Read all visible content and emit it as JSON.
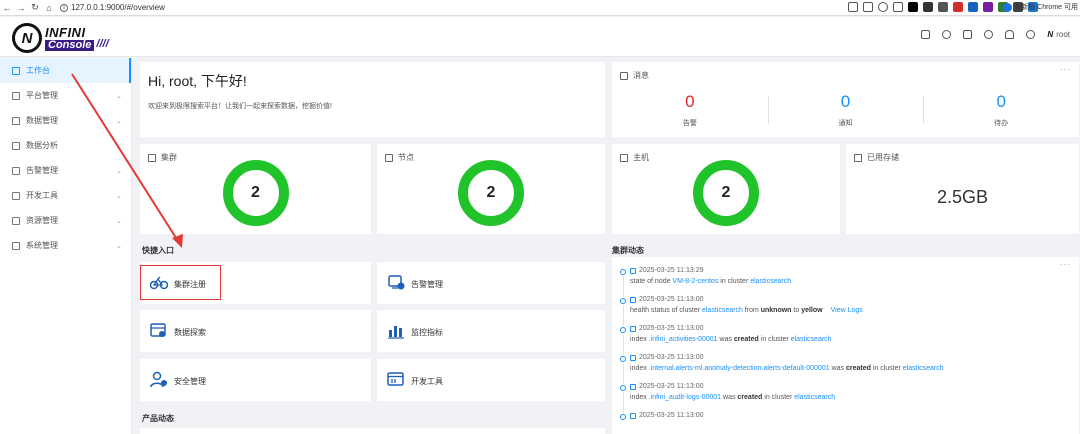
{
  "browser": {
    "url": "127.0.0.1:9000/#/overview",
    "update_text": "有新版 Chrome 可用",
    "ext_colors": [
      "#000000",
      "#333333",
      "#555555",
      "#d32f2f",
      "#1565c0",
      "#7b1fa2",
      "#2e7d32",
      "#424242",
      "#1976d2"
    ]
  },
  "logo": {
    "top": "INFINI",
    "bottom": "Console"
  },
  "header": {
    "user": "root"
  },
  "sidebar": {
    "items": [
      {
        "label": "工作台",
        "icon": "home-icon",
        "active": true,
        "expandable": false
      },
      {
        "label": "平台管理",
        "icon": "platform-icon",
        "active": false,
        "expandable": true
      },
      {
        "label": "数据管理",
        "icon": "data-icon",
        "active": false,
        "expandable": true
      },
      {
        "label": "数据分析",
        "icon": "analysis-icon",
        "active": false,
        "expandable": false
      },
      {
        "label": "告警管理",
        "icon": "alert-icon",
        "active": false,
        "expandable": true
      },
      {
        "label": "开发工具",
        "icon": "devtools-icon",
        "active": false,
        "expandable": true
      },
      {
        "label": "资源管理",
        "icon": "resource-icon",
        "active": false,
        "expandable": true
      },
      {
        "label": "系统管理",
        "icon": "system-icon",
        "active": false,
        "expandable": true
      }
    ]
  },
  "greeting": {
    "title": "Hi, root, 下午好!",
    "subtitle": "欢迎来到极限搜索平台！让我们一起来探索数据，挖掘价值!"
  },
  "messages": {
    "title": "消息",
    "items": [
      {
        "value": "0",
        "label": "告警"
      },
      {
        "value": "0",
        "label": "通知"
      },
      {
        "value": "0",
        "label": "待办"
      }
    ]
  },
  "stats": {
    "clusters": {
      "title": "集群",
      "value": "2"
    },
    "nodes": {
      "title": "节点",
      "value": "2"
    },
    "hosts": {
      "title": "主机",
      "value": "2"
    },
    "storage": {
      "title": "已用存储",
      "value": "2.5GB"
    }
  },
  "quick": {
    "title": "快捷入口",
    "items": [
      {
        "label": "集群注册"
      },
      {
        "label": "告警管理"
      },
      {
        "label": "数据探索"
      },
      {
        "label": "监控指标"
      },
      {
        "label": "安全管理"
      },
      {
        "label": "开发工具"
      }
    ]
  },
  "product_news": {
    "title": "产品动态"
  },
  "activity": {
    "title": "集群动态",
    "items": [
      {
        "time": "2025-03-25 11:13:29",
        "text": [
          "state of node ",
          "VM-8-2-centos",
          " in cluster ",
          "elasticsearch",
          "",
          "",
          ""
        ]
      },
      {
        "time": "2025-03-25 11:13:00",
        "text": [
          "health status of cluster ",
          "elasticsearch",
          " from ",
          "unknown",
          " to ",
          "yellow",
          "View Logs"
        ]
      },
      {
        "time": "2025-03-25 11:13:00",
        "text": [
          "index ",
          ".infini_activities-00001",
          " was ",
          "created",
          " in cluster ",
          "elasticsearch",
          ""
        ]
      },
      {
        "time": "2025-03-25 11:13:00",
        "text": [
          "index ",
          ".internal.alerts-ml.anomaly-detection.alerts-default-000001",
          " was ",
          "created",
          " in cluster ",
          "elasticsearch",
          ""
        ]
      },
      {
        "time": "2025-03-25 11:13:00",
        "text": [
          "index ",
          ".infini_audit-logs-00001",
          " was ",
          "created",
          " in cluster ",
          "elasticsearch",
          ""
        ]
      },
      {
        "time": "2025-03-25 11:13:00",
        "text": [
          "",
          "",
          "",
          "",
          "",
          "",
          ""
        ]
      }
    ]
  }
}
